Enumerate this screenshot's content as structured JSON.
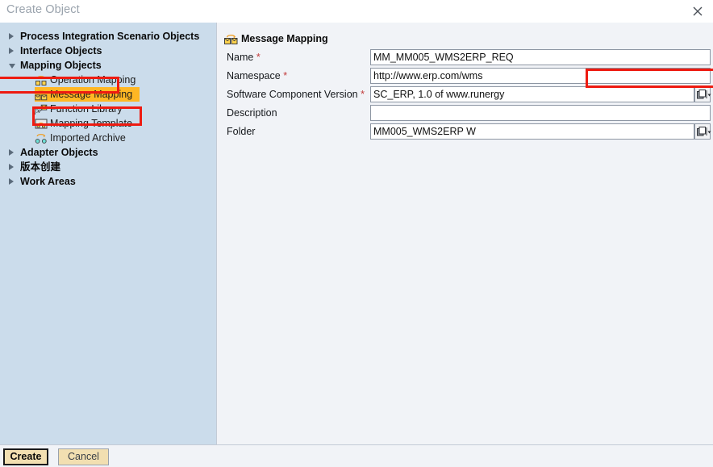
{
  "window": {
    "title": "Create Object",
    "close_icon": "close-icon"
  },
  "sidebar": {
    "tree": [
      {
        "label": "Process Integration Scenario Objects",
        "level": "top",
        "state": "collapsed",
        "icon": null,
        "highlighted": false
      },
      {
        "label": "Interface Objects",
        "level": "top",
        "state": "collapsed",
        "icon": null,
        "highlighted": false
      },
      {
        "label": "Mapping Objects",
        "level": "top",
        "state": "expanded",
        "icon": null,
        "highlighted": false,
        "annotated": true
      },
      {
        "label": "Operation Mapping",
        "level": "child",
        "state": "leaf",
        "icon": "operation-mapping-icon",
        "highlighted": false
      },
      {
        "label": "Message Mapping",
        "level": "child",
        "state": "leaf",
        "icon": "message-mapping-icon",
        "highlighted": true,
        "annotated": true
      },
      {
        "label": "Function Library",
        "level": "child",
        "state": "leaf",
        "icon": "function-library-icon",
        "highlighted": false
      },
      {
        "label": "Mapping Template",
        "level": "child",
        "state": "leaf",
        "icon": "mapping-template-icon",
        "highlighted": false
      },
      {
        "label": "Imported Archive",
        "level": "child",
        "state": "leaf",
        "icon": "imported-archive-icon",
        "highlighted": false
      },
      {
        "label": "Adapter Objects",
        "level": "top",
        "state": "collapsed",
        "icon": null,
        "highlighted": false
      },
      {
        "label": "版本创建",
        "level": "top",
        "state": "collapsed",
        "icon": null,
        "highlighted": false
      },
      {
        "label": "Work Areas",
        "level": "top",
        "state": "collapsed",
        "icon": null,
        "highlighted": false
      }
    ]
  },
  "form": {
    "header": "Message Mapping",
    "header_icon": "message-mapping-icon",
    "fields": [
      {
        "label": "Name",
        "required": true,
        "value": "MM_MM005_WMS2ERP_REQ",
        "picker": false,
        "annotated": true,
        "redacted": false
      },
      {
        "label": "Namespace",
        "required": true,
        "value": "http://www.erp.com/wms",
        "picker": false,
        "annotated": false,
        "redacted": false
      },
      {
        "label": "Software Component Version",
        "required": true,
        "value": "SC_ERP, 1.0 of www.runergy",
        "picker": true,
        "annotated": false,
        "redacted": false
      },
      {
        "label": "Description",
        "required": false,
        "value": "",
        "picker": false,
        "annotated": false,
        "redacted": false
      },
      {
        "label": "Folder",
        "required": false,
        "value": "MM005_WMS2ERP W",
        "picker": true,
        "annotated": false,
        "redacted": true
      }
    ],
    "required_marker": "*"
  },
  "footer": {
    "create_label": "Create",
    "cancel_label": "Cancel"
  },
  "colors": {
    "sidebar_bg": "#cbdceb",
    "panel_bg": "#f1f3f7",
    "annotation_red": "#ee1b11",
    "selection_orange": "#ffb724",
    "button_face": "#f2dfb1",
    "required_red": "#c23b3b"
  }
}
